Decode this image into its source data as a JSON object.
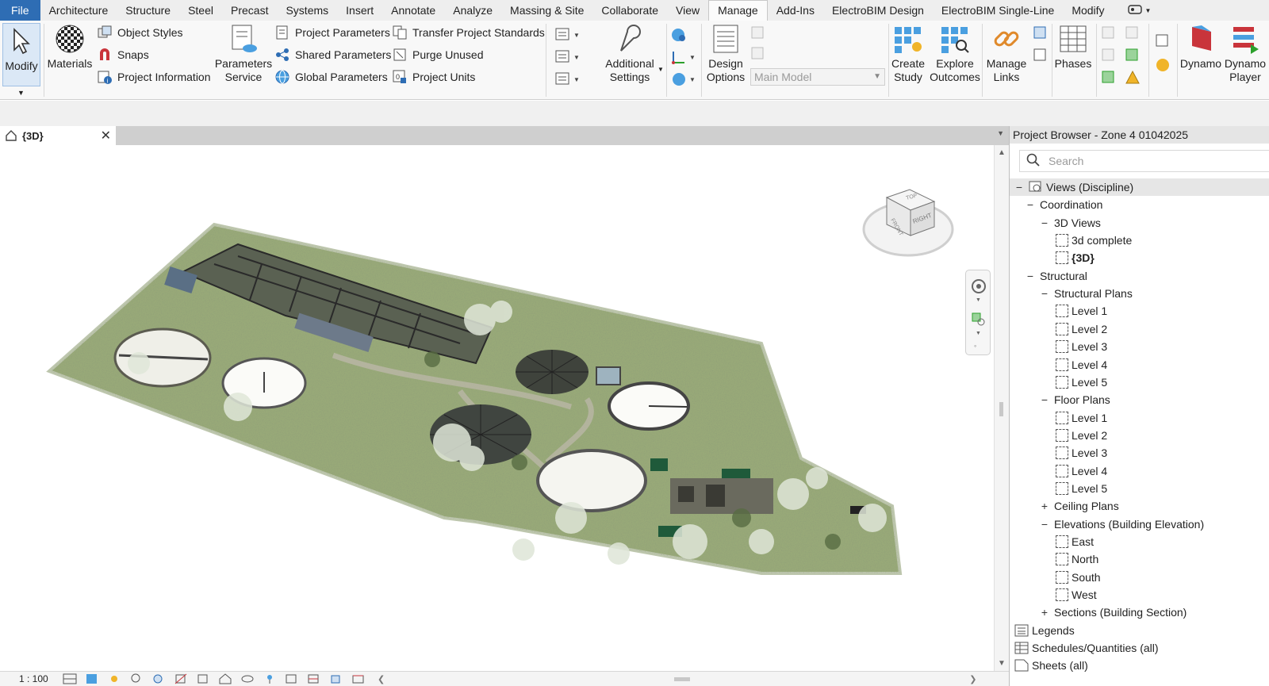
{
  "menu": {
    "tabs": [
      "File",
      "Architecture",
      "Structure",
      "Steel",
      "Precast",
      "Systems",
      "Insert",
      "Annotate",
      "Analyze",
      "Massing & Site",
      "Collaborate",
      "View",
      "Manage",
      "Add-Ins",
      "ElectroBIM Design",
      "ElectroBIM Single-Line",
      "Modify"
    ],
    "active_tab": "Manage"
  },
  "ribbon": {
    "modify": "Modify",
    "materials": "Materials",
    "object_styles": "Object Styles",
    "snaps": "Snaps",
    "project_information": "Project Information",
    "parameters_service": [
      "Parameters",
      "Service"
    ],
    "project_parameters": "Project Parameters",
    "shared_parameters": "Shared Parameters",
    "global_parameters": "Global Parameters",
    "transfer_project_standards": "Transfer Project Standards",
    "purge_unused": "Purge Unused",
    "project_units": "Project Units",
    "additional_settings": [
      "Additional",
      "Settings"
    ],
    "design_options": [
      "Design",
      "Options"
    ],
    "design_option_combo": "Main Model",
    "create_study": [
      "Create",
      "Study"
    ],
    "explore_outcomes": [
      "Explore",
      "Outcomes"
    ],
    "manage_links": [
      "Manage",
      "Links"
    ],
    "phases": "Phases",
    "dynamo": "Dynamo",
    "dynamo_player": [
      "Dynamo",
      "Player"
    ]
  },
  "view": {
    "tab_title": "{3D}",
    "scale": "1 : 100"
  },
  "browser": {
    "title": "Project Browser - Zone 4 01042025",
    "search_placeholder": "Search",
    "rows": [
      {
        "label": "Views (Discipline)",
        "indent": 0,
        "toggle": "−",
        "icon": "views"
      },
      {
        "label": "Coordination",
        "indent": 1,
        "toggle": "−"
      },
      {
        "label": "3D Views",
        "indent": 2,
        "toggle": "−"
      },
      {
        "label": "3d complete",
        "indent": 3,
        "icon": "view"
      },
      {
        "label": "{3D}",
        "indent": 3,
        "icon": "view",
        "bold": true
      },
      {
        "label": "Structural",
        "indent": 1,
        "toggle": "−"
      },
      {
        "label": "Structural Plans",
        "indent": 2,
        "toggle": "−"
      },
      {
        "label": "Level 1",
        "indent": 3,
        "icon": "view"
      },
      {
        "label": "Level 2",
        "indent": 3,
        "icon": "view"
      },
      {
        "label": "Level 3",
        "indent": 3,
        "icon": "view"
      },
      {
        "label": "Level 4",
        "indent": 3,
        "icon": "view"
      },
      {
        "label": "Level 5",
        "indent": 3,
        "icon": "view"
      },
      {
        "label": "Floor Plans",
        "indent": 2,
        "toggle": "−"
      },
      {
        "label": "Level 1",
        "indent": 3,
        "icon": "view"
      },
      {
        "label": "Level 2",
        "indent": 3,
        "icon": "view"
      },
      {
        "label": "Level 3",
        "indent": 3,
        "icon": "view"
      },
      {
        "label": "Level 4",
        "indent": 3,
        "icon": "view"
      },
      {
        "label": "Level 5",
        "indent": 3,
        "icon": "view"
      },
      {
        "label": "Ceiling Plans",
        "indent": 2,
        "toggle": "+"
      },
      {
        "label": "Elevations (Building Elevation)",
        "indent": 2,
        "toggle": "−"
      },
      {
        "label": "East",
        "indent": 3,
        "icon": "view"
      },
      {
        "label": "North",
        "indent": 3,
        "icon": "view"
      },
      {
        "label": "South",
        "indent": 3,
        "icon": "view"
      },
      {
        "label": "West",
        "indent": 3,
        "icon": "view"
      },
      {
        "label": "Sections (Building Section)",
        "indent": 2,
        "toggle": "+"
      },
      {
        "label": "Legends",
        "indent": 0,
        "icon": "legend"
      },
      {
        "label": "Schedules/Quantities (all)",
        "indent": 0,
        "icon": "schedule"
      },
      {
        "label": "Sheets (all)",
        "indent": 0,
        "icon": "sheet"
      }
    ]
  },
  "viewcube": {
    "faces": [
      "TOP",
      "FRONT",
      "RIGHT"
    ]
  },
  "colors": {
    "file_tab": "#2e6db4",
    "accent": "#2e6db4",
    "grass": "#8fa36a"
  }
}
